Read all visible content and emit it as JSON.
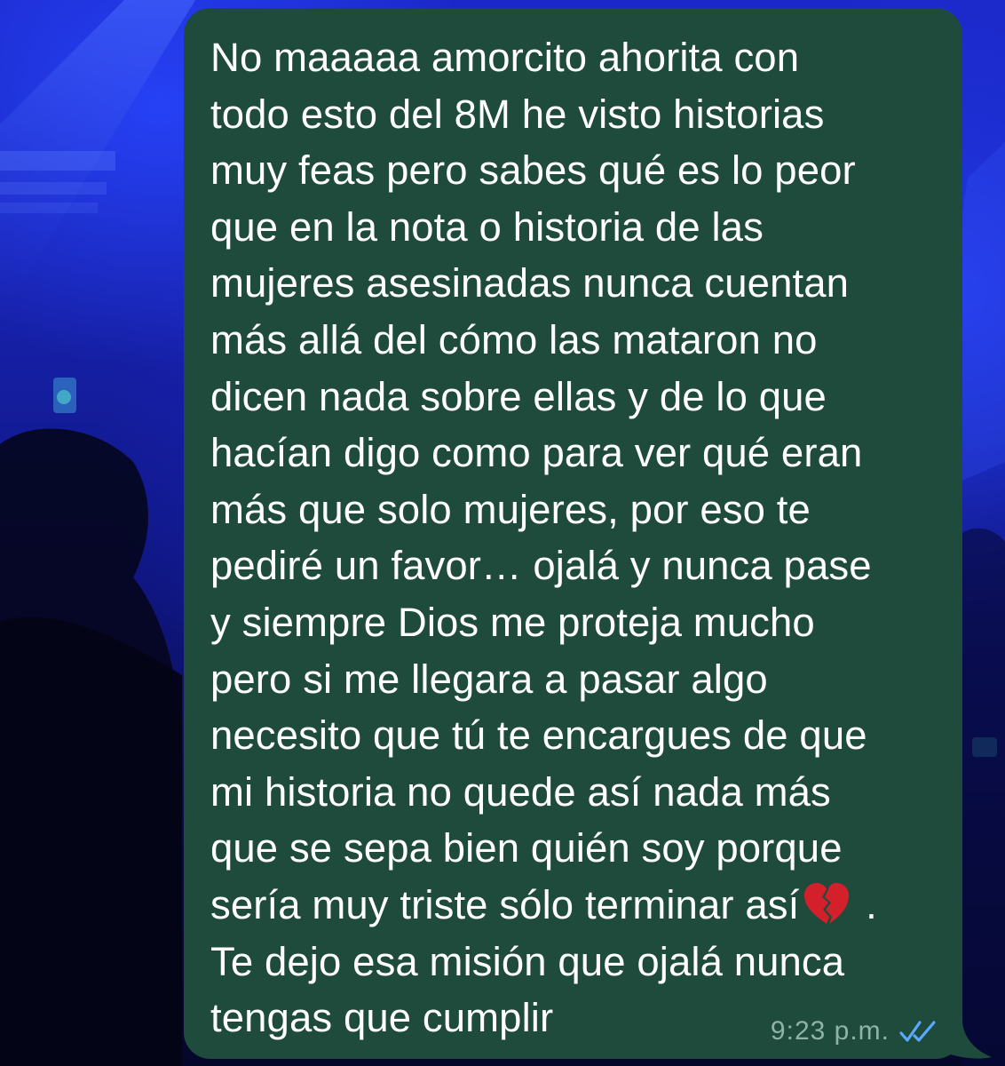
{
  "message": {
    "lines": [
      "No maaaaa amorcito ahorita con",
      "todo esto del 8M he visto historias",
      "muy feas pero sabes qué es lo peor",
      "que en la nota o historia de las",
      "mujeres asesinadas nunca cuentan",
      "más allá del cómo las mataron no",
      "dicen nada sobre ellas y de lo que",
      "hacían digo como para ver qué eran",
      "más que solo mujeres, por eso te",
      "pediré un favor… ojalá y nunca pase",
      "y siempre Dios me proteja mucho",
      "pero si me llegara a pasar algo",
      "necesito que tú te encargues de que",
      "mi historia no quede así nada más",
      "que se sepa bien quién soy porque"
    ],
    "line_before_emoji": "sería muy triste sólo terminar así",
    "line_after_emoji": " .",
    "closing_lines": [
      "Te dejo esa misión que ojalá nunca",
      "tengas que cumplir"
    ],
    "emoji": "broken-heart-icon",
    "timestamp": "9:23 p.m.",
    "status_icon": "double-check-read-icon"
  },
  "colors": {
    "bubble": "#1f4b3c",
    "text": "#ffffff",
    "timestamp": "#8fb3a5",
    "read_ticks": "#5aa9ff",
    "broken_heart": "#d4202b"
  }
}
